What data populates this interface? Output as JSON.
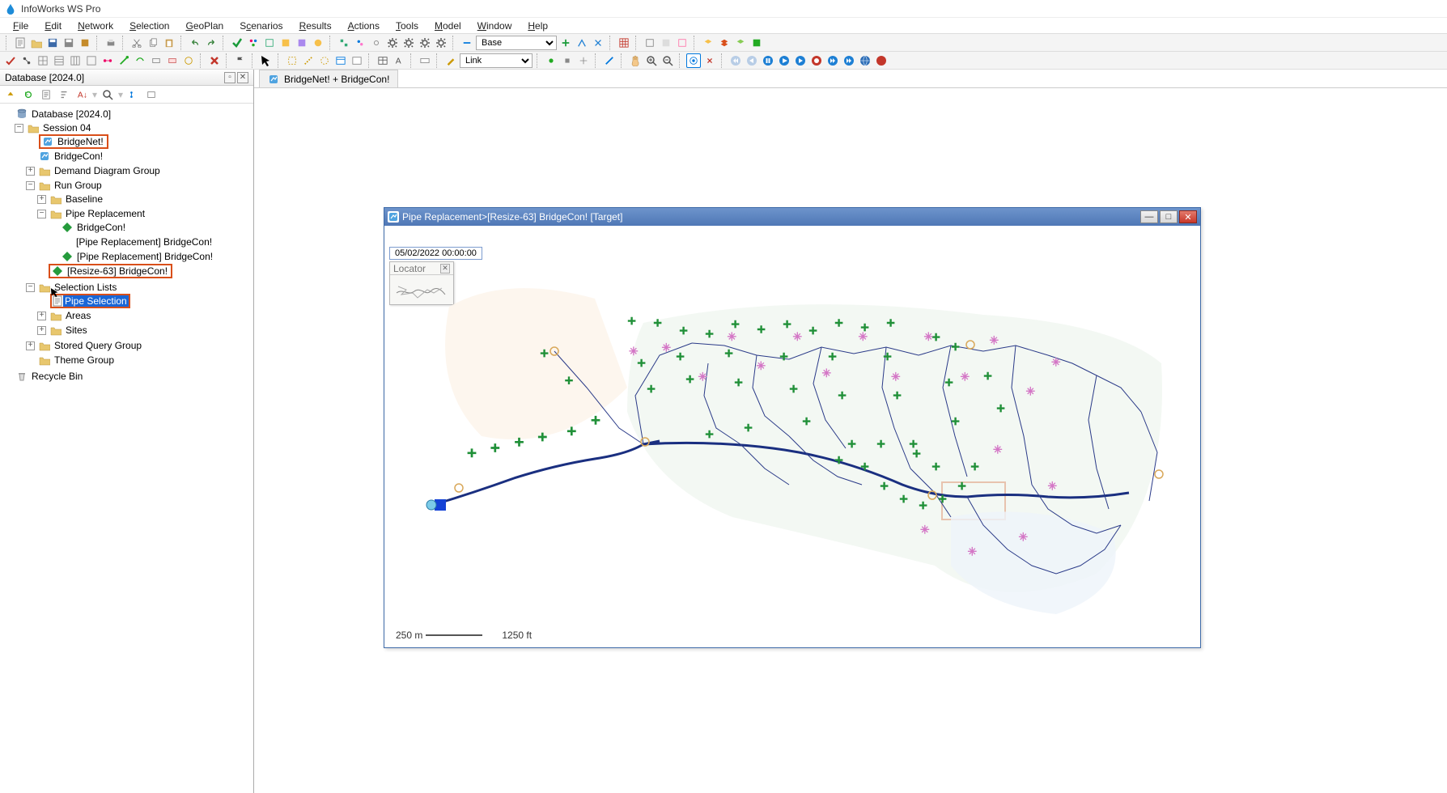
{
  "app": {
    "title": "InfoWorks WS Pro"
  },
  "menu": [
    "File",
    "Edit",
    "Network",
    "Selection",
    "GeoPlan",
    "Scenarios",
    "Results",
    "Actions",
    "Tools",
    "Model",
    "Window",
    "Help"
  ],
  "toolbar": {
    "scenario_select": "Base",
    "link_select": "Link"
  },
  "db_panel": {
    "title": "Database [2024.0]",
    "root": "Database [2024.0]",
    "session": "Session 04",
    "bridgenet": "BridgeNet!",
    "bridgecon": "BridgeCon!",
    "ddg": "Demand Diagram Group",
    "rungroup": "Run Group",
    "baseline": "Baseline",
    "pipe_repl": "Pipe Replacement",
    "pr_bcon1": "BridgeCon!",
    "pr_bcon2": "[Pipe Replacement] BridgeCon!",
    "pr_bcon3": "[Pipe Replacement] BridgeCon!",
    "pr_resize": "[Resize-63] BridgeCon!",
    "sel_lists": "Selection Lists",
    "pipe_sel": "Pipe Selection",
    "areas": "Areas",
    "sites": "Sites",
    "sqg": "Stored Query Group",
    "tg": "Theme Group",
    "rbin": "Recycle Bin"
  },
  "doc_tab": "BridgeNet! + BridgeCon!",
  "float_window": {
    "title": "Pipe Replacement>[Resize-63] BridgeCon!  [Target]",
    "timestamp": "05/02/2022 00:00:00",
    "locator": "Locator",
    "scale_m": "250 m",
    "scale_ft": "1250 ft"
  }
}
